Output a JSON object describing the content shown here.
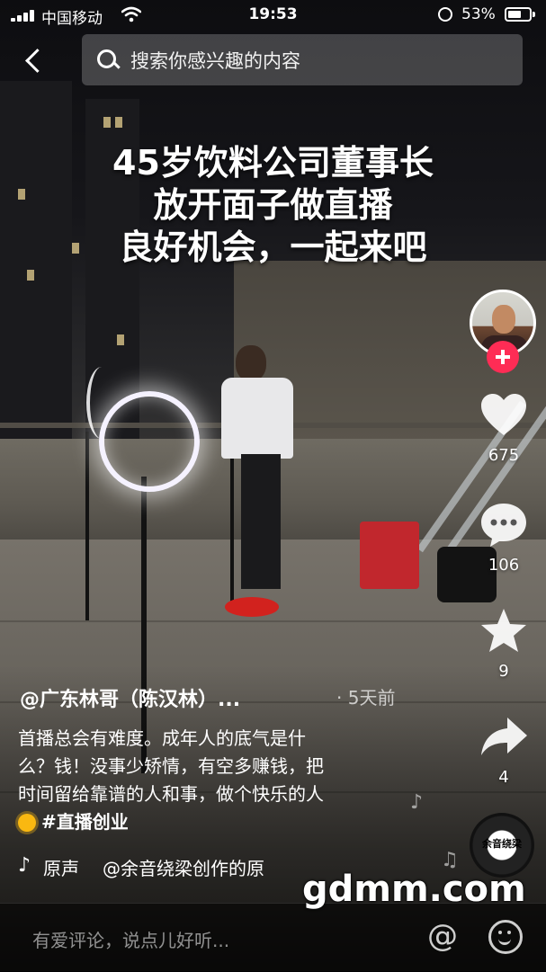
{
  "status_bar": {
    "carrier": "中国移动",
    "time": "19:53",
    "battery": "53%"
  },
  "search": {
    "placeholder": "搜索你感兴趣的内容"
  },
  "caption": {
    "lines": [
      "45岁饮料公司董事长",
      "放开面子做直播",
      "良好机会，一起来吧"
    ]
  },
  "right_rail": {
    "likes": "675",
    "comments": "106",
    "favorites": "9",
    "shares": "4",
    "disc_label": "余音绕梁"
  },
  "post": {
    "author": "@广东林哥（陈汉林）...",
    "time": "· 5天前",
    "description_lines": [
      "首播总会有难度。成年人的底气是什",
      "么？钱！没事少矫情，有空多赚钱，把",
      "时间留给靠谱的人和事，做个快乐的人"
    ],
    "hashtag": "#直播创业",
    "sound_origin": "原声",
    "sound_creator": "@余音绕梁创作的原"
  },
  "comment_bar": {
    "placeholder": "有爱评论，说点儿好听...",
    "at_symbol": "@"
  },
  "watermark": "gdmm.com",
  "colors": {
    "follow_accent": "#fe2c55",
    "stool_red": "#c1272d"
  }
}
